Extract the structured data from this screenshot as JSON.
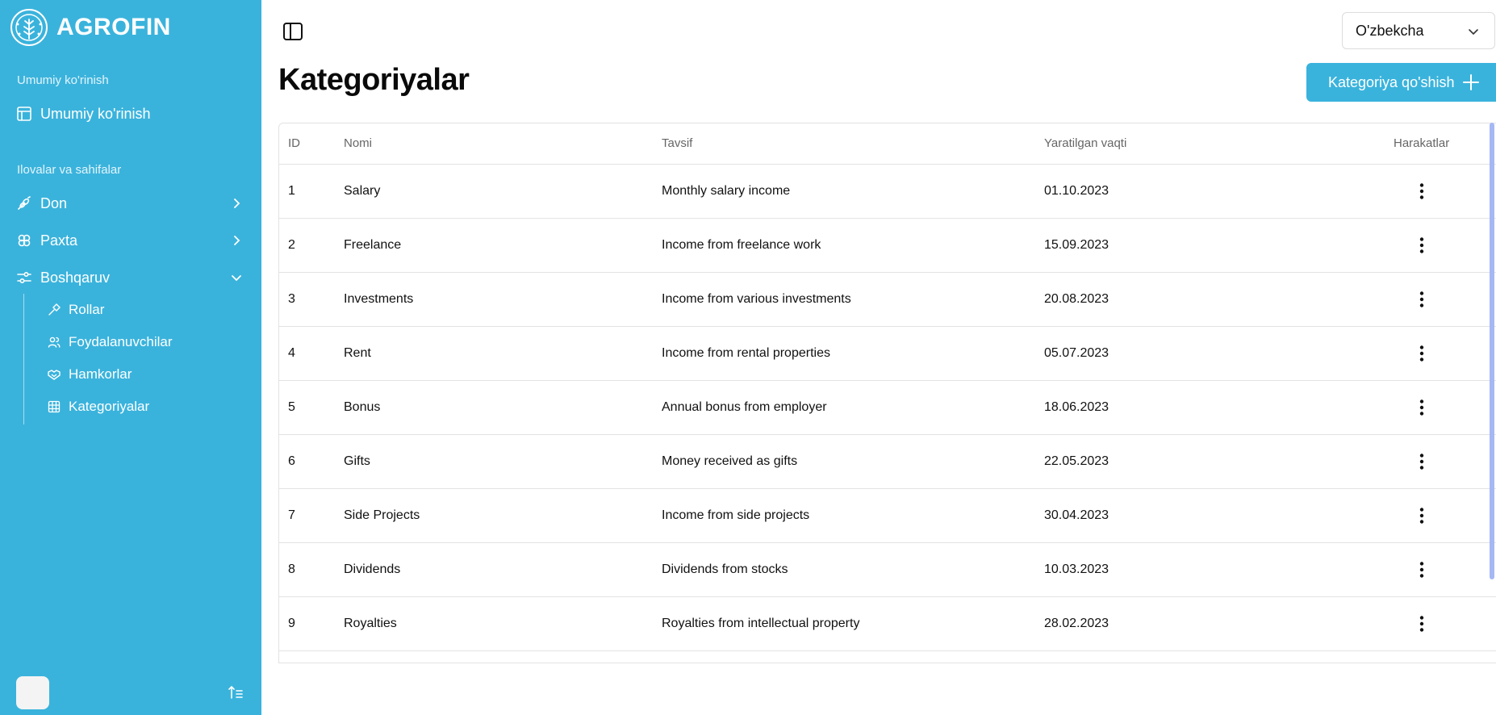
{
  "brand": {
    "name": "AGROFIN"
  },
  "sidebar": {
    "section_overview": "Umumiy ko'rinish",
    "overview_item": "Umumiy ko'rinish",
    "section_apps": "Ilovalar va sahifalar",
    "items": [
      {
        "label": "Don",
        "icon": "wheat-icon"
      },
      {
        "label": "Paxta",
        "icon": "cotton-icon"
      },
      {
        "label": "Boshqaruv",
        "icon": "settings-sliders-icon"
      }
    ],
    "subitems": [
      {
        "label": "Rollar",
        "icon": "hammer-icon"
      },
      {
        "label": "Foydalanuvchilar",
        "icon": "users-icon"
      },
      {
        "label": "Hamkorlar",
        "icon": "handshake-icon"
      },
      {
        "label": "Kategoriyalar",
        "icon": "grid-icon"
      }
    ]
  },
  "header": {
    "language": "O'zbekcha",
    "title": "Kategoriyalar",
    "add_button": "Kategoriya qo'shish"
  },
  "table": {
    "columns": [
      "ID",
      "Nomi",
      "Tavsif",
      "Yaratilgan vaqti",
      "Harakatlar"
    ],
    "rows": [
      {
        "id": "1",
        "name": "Salary",
        "desc": "Monthly salary income",
        "date": "01.10.2023"
      },
      {
        "id": "2",
        "name": "Freelance",
        "desc": "Income from freelance work",
        "date": "15.09.2023"
      },
      {
        "id": "3",
        "name": "Investments",
        "desc": "Income from various investments",
        "date": "20.08.2023"
      },
      {
        "id": "4",
        "name": "Rent",
        "desc": "Income from rental properties",
        "date": "05.07.2023"
      },
      {
        "id": "5",
        "name": "Bonus",
        "desc": "Annual bonus from employer",
        "date": "18.06.2023"
      },
      {
        "id": "6",
        "name": "Gifts",
        "desc": "Money received as gifts",
        "date": "22.05.2023"
      },
      {
        "id": "7",
        "name": "Side Projects",
        "desc": "Income from side projects",
        "date": "30.04.2023"
      },
      {
        "id": "8",
        "name": "Dividends",
        "desc": "Dividends from stocks",
        "date": "10.03.2023"
      },
      {
        "id": "9",
        "name": "Royalties",
        "desc": "Royalties from intellectual property",
        "date": "28.02.2023"
      }
    ]
  },
  "colors": {
    "accent": "#3ab3dc",
    "border": "#e3e3e3",
    "scrollbar": "#a5b8f5"
  }
}
